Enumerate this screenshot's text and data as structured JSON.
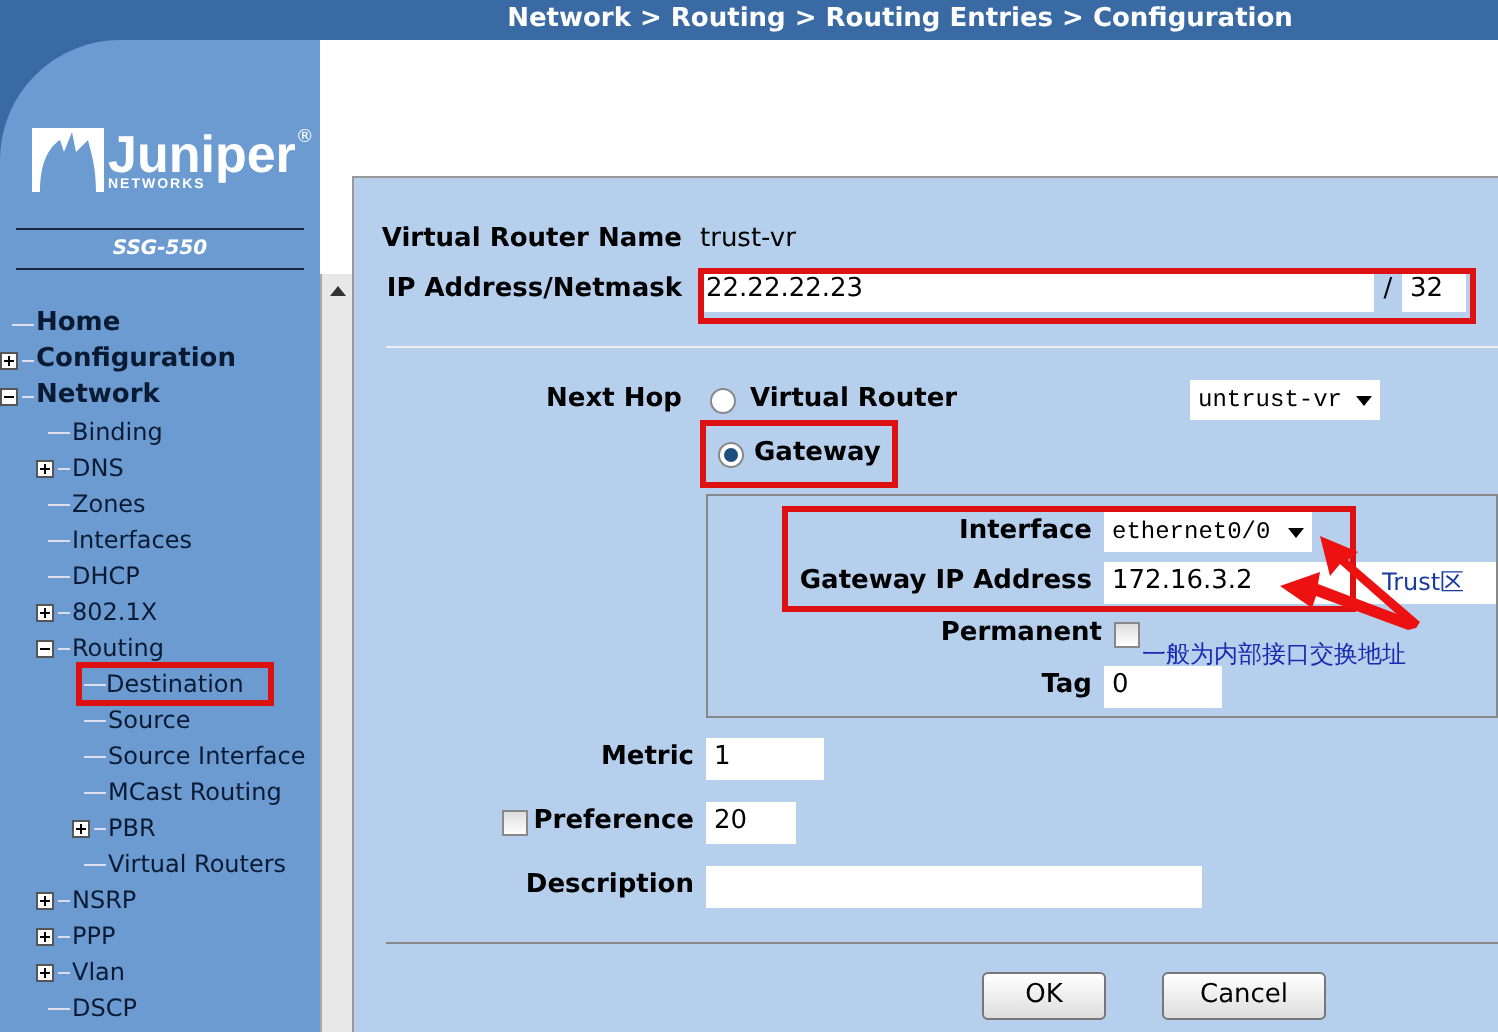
{
  "breadcrumb": "Network > Routing > Routing Entries > Configuration",
  "logo": {
    "name": "Juniper",
    "mark": "®",
    "sub": "NETWORKS"
  },
  "device": "SSG-550",
  "tree": [
    {
      "label": "Home",
      "selected": false
    },
    {
      "label": "Configuration",
      "selected": false,
      "expanded": false
    },
    {
      "label": "Network",
      "selected": false,
      "expanded": true,
      "children": [
        {
          "label": "Binding",
          "selected": false
        },
        {
          "label": "DNS",
          "selected": false,
          "expanded": false
        },
        {
          "label": "Zones",
          "selected": false
        },
        {
          "label": "Interfaces",
          "selected": false
        },
        {
          "label": "DHCP",
          "selected": false
        },
        {
          "label": "802.1X",
          "selected": false,
          "expanded": false
        },
        {
          "label": "Routing",
          "selected": false,
          "expanded": true,
          "children": [
            {
              "label": "Destination",
              "selected": true
            },
            {
              "label": "Source",
              "selected": false
            },
            {
              "label": "Source Interface",
              "selected": false
            },
            {
              "label": "MCast Routing",
              "selected": false
            },
            {
              "label": "PBR",
              "selected": false,
              "expanded": false
            },
            {
              "label": "Virtual Routers",
              "selected": false
            }
          ]
        },
        {
          "label": "NSRP",
          "selected": false,
          "expanded": false
        },
        {
          "label": "PPP",
          "selected": false,
          "expanded": false
        },
        {
          "label": "Vlan",
          "selected": false,
          "expanded": false
        },
        {
          "label": "DSCP",
          "selected": false
        }
      ]
    }
  ],
  "form": {
    "vr_name": {
      "label": "Virtual Router Name",
      "value": "trust-vr"
    },
    "ip": {
      "label": "IP Address/Netmask",
      "value": "22.22.22.23",
      "separator": "/",
      "mask": "32"
    },
    "next_hop": {
      "label": "Next Hop",
      "options": [
        {
          "label": "Virtual Router",
          "selected": false
        },
        {
          "label": "Gateway",
          "selected": true
        }
      ],
      "vr_select": "untrust-vr"
    },
    "interface": {
      "label": "Interface",
      "value": "ethernet0/0"
    },
    "gateway_ip": {
      "label": "Gateway IP Address",
      "value": "172.16.3.2"
    },
    "permanent": {
      "label": "Permanent",
      "checked": false
    },
    "tag": {
      "label": "Tag",
      "value": "0"
    },
    "metric": {
      "label": "Metric",
      "value": "1"
    },
    "preference": {
      "label": "Preference",
      "checked": false,
      "value": "20"
    },
    "description": {
      "label": "Description"
    },
    "buttons": [
      "OK",
      "Cancel"
    ]
  },
  "annotations": {
    "zone_note": "Trust区",
    "gateway_note": "一般为内部接口交换地址"
  }
}
